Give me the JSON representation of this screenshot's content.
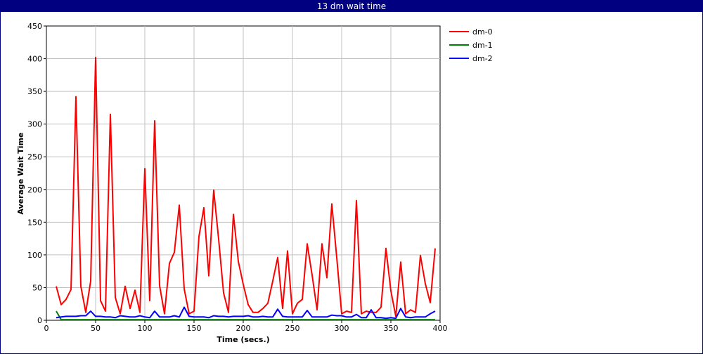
{
  "window": {
    "title": "13 dm wait time"
  },
  "colors": {
    "titlebar_bg": "#000080",
    "grid": "#c0c0c0",
    "axis": "#000000"
  },
  "chart_data": {
    "type": "line",
    "title": "13 dm wait time",
    "xlabel": "Time (secs.)",
    "ylabel": "Average Wait Time",
    "xlim": [
      0,
      400
    ],
    "ylim": [
      0,
      450
    ],
    "xticks": [
      0,
      50,
      100,
      150,
      200,
      250,
      300,
      350,
      400
    ],
    "yticks": [
      0,
      50,
      100,
      150,
      200,
      250,
      300,
      350,
      400,
      450
    ],
    "grid": true,
    "legend_position": "right",
    "series": [
      {
        "name": "dm-0",
        "color": "#ff0000",
        "x": [
          10,
          15,
          20,
          25,
          30,
          35,
          40,
          45,
          50,
          55,
          60,
          65,
          70,
          75,
          80,
          85,
          90,
          95,
          100,
          105,
          110,
          115,
          120,
          125,
          130,
          135,
          140,
          145,
          150,
          155,
          160,
          165,
          170,
          175,
          180,
          185,
          190,
          195,
          200,
          205,
          210,
          215,
          220,
          225,
          230,
          235,
          240,
          245,
          250,
          255,
          260,
          265,
          270,
          275,
          280,
          285,
          290,
          295,
          300,
          305,
          310,
          315,
          320,
          325,
          330,
          335,
          340,
          345,
          350,
          355,
          360,
          365,
          370,
          375,
          380,
          385,
          390,
          395
        ],
        "y": [
          52,
          24,
          32,
          47,
          342,
          52,
          12,
          60,
          402,
          30,
          14,
          315,
          35,
          10,
          52,
          18,
          46,
          12,
          232,
          30,
          305,
          53,
          10,
          87,
          104,
          176,
          48,
          10,
          14,
          128,
          172,
          68,
          199,
          124,
          42,
          12,
          162,
          90,
          55,
          24,
          12,
          12,
          18,
          26,
          60,
          96,
          18,
          106,
          10,
          26,
          32,
          117,
          69,
          16,
          117,
          65,
          178,
          96,
          10,
          14,
          12,
          183,
          10,
          14,
          12,
          12,
          20,
          110,
          45,
          6,
          89,
          10,
          16,
          12,
          99,
          56,
          27,
          110
        ]
      },
      {
        "name": "dm-1",
        "color": "#008000",
        "x": [
          10,
          15,
          20,
          25,
          30,
          35,
          40,
          45,
          50,
          55,
          60,
          65,
          70,
          75,
          80,
          85,
          90,
          95,
          100,
          105,
          110,
          115,
          120,
          125,
          130,
          135,
          140,
          145,
          150,
          155,
          160,
          165,
          170,
          175,
          180,
          185,
          190,
          195,
          200,
          205,
          210,
          215,
          220,
          225,
          230,
          235,
          240,
          245,
          250,
          255,
          260,
          265,
          270,
          275,
          280,
          285,
          290,
          295,
          300,
          305,
          310,
          315,
          320,
          325,
          330,
          335,
          340,
          345,
          350,
          355,
          360,
          365,
          370,
          375,
          380,
          385,
          390,
          395
        ],
        "y": [
          14,
          1,
          1,
          1,
          1,
          1,
          1,
          1,
          1,
          1,
          1,
          1,
          1,
          1,
          1,
          1,
          1,
          1,
          1,
          1,
          1,
          1,
          1,
          1,
          1,
          1,
          1,
          1,
          1,
          1,
          1,
          1,
          1,
          1,
          1,
          1,
          1,
          1,
          1,
          1,
          1,
          1,
          1,
          1,
          1,
          1,
          1,
          1,
          1,
          1,
          1,
          1,
          1,
          1,
          1,
          1,
          1,
          1,
          1,
          1,
          1,
          1,
          1,
          1,
          1,
          1,
          1,
          1,
          1,
          1,
          1,
          1,
          1,
          1,
          1,
          1,
          1,
          1
        ]
      },
      {
        "name": "dm-2",
        "color": "#0000ff",
        "x": [
          10,
          15,
          20,
          25,
          30,
          35,
          40,
          45,
          50,
          55,
          60,
          65,
          70,
          75,
          80,
          85,
          90,
          95,
          100,
          105,
          110,
          115,
          120,
          125,
          130,
          135,
          140,
          145,
          150,
          155,
          160,
          165,
          170,
          175,
          180,
          185,
          190,
          195,
          200,
          205,
          210,
          215,
          220,
          225,
          230,
          235,
          240,
          245,
          250,
          255,
          260,
          265,
          270,
          275,
          280,
          285,
          290,
          295,
          300,
          305,
          310,
          315,
          320,
          325,
          330,
          335,
          340,
          345,
          350,
          355,
          360,
          365,
          370,
          375,
          380,
          385,
          390,
          395
        ],
        "y": [
          4,
          5,
          6,
          6,
          6,
          7,
          7,
          14,
          6,
          6,
          5,
          5,
          4,
          7,
          6,
          5,
          5,
          7,
          5,
          4,
          14,
          5,
          5,
          5,
          7,
          5,
          20,
          6,
          5,
          5,
          5,
          4,
          7,
          6,
          6,
          5,
          6,
          6,
          6,
          7,
          5,
          5,
          6,
          5,
          5,
          17,
          6,
          5,
          5,
          5,
          5,
          15,
          5,
          5,
          5,
          5,
          8,
          7,
          7,
          5,
          5,
          9,
          4,
          4,
          16,
          4,
          4,
          3,
          4,
          3,
          18,
          5,
          4,
          5,
          5,
          5,
          10,
          14
        ]
      }
    ]
  }
}
